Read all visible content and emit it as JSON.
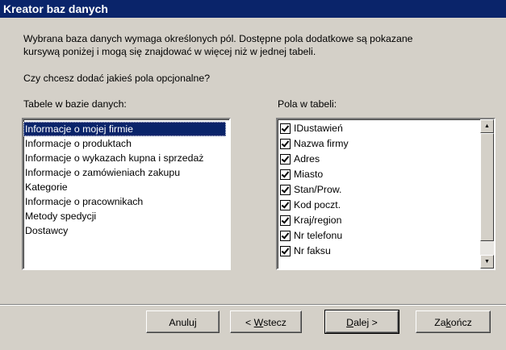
{
  "window": {
    "title": "Kreator baz danych"
  },
  "intro": {
    "line1": "Wybrana baza danych wymaga określonych pól. Dostępne pola dodatkowe są pokazane",
    "line2": "kursywą poniżej i mogą się znajdować w więcej niż w jednej tabeli.",
    "question": "Czy chcesz dodać jakieś pola opcjonalne?"
  },
  "tables": {
    "label": "Tabele w bazie danych:",
    "items": [
      "Informacje o mojej firmie",
      "Informacje o produktach",
      "Informacje o wykazach kupna i sprzedaż",
      "Informacje o zamówieniach zakupu",
      "Kategorie",
      "Informacje o pracownikach",
      "Metody spedycji",
      "Dostawcy"
    ],
    "selected_index": 0
  },
  "fields": {
    "label": "Pola w tabeli:",
    "items": [
      {
        "name": "IDustawień",
        "checked": true
      },
      {
        "name": "Nazwa firmy",
        "checked": true
      },
      {
        "name": "Adres",
        "checked": true
      },
      {
        "name": "Miasto",
        "checked": true
      },
      {
        "name": "Stan/Prow.",
        "checked": true
      },
      {
        "name": "Kod poczt.",
        "checked": true
      },
      {
        "name": "Kraj/region",
        "checked": true
      },
      {
        "name": "Nr telefonu",
        "checked": true
      },
      {
        "name": "Nr faksu",
        "checked": true
      }
    ]
  },
  "buttons": {
    "cancel": "Anuluj",
    "back_prefix": "< ",
    "back_key": "W",
    "back_rest": "stecz",
    "next_key": "D",
    "next_rest": "alej >",
    "finish_start": "Za",
    "finish_key": "k",
    "finish_rest": "ończ"
  }
}
